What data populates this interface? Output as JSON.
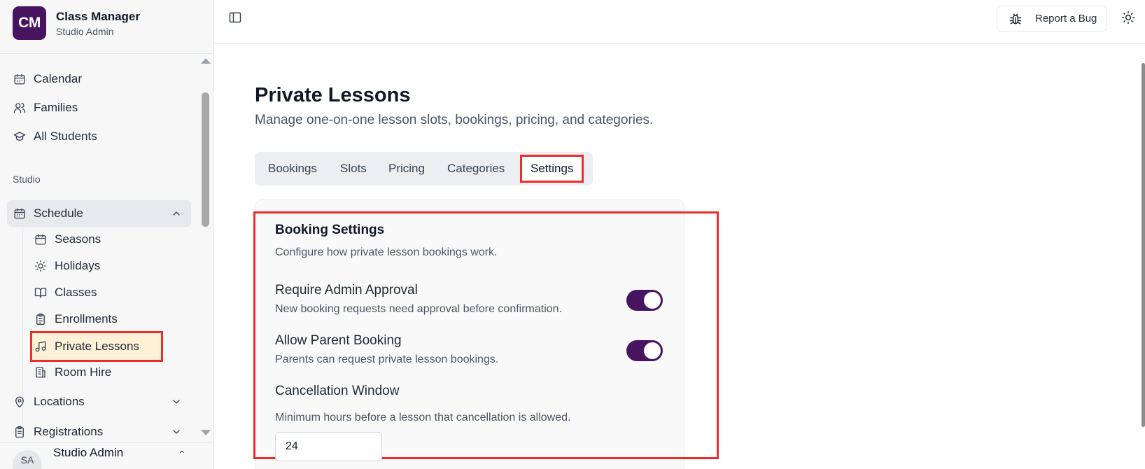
{
  "brand": {
    "logo_text": "CM",
    "name": "Class Manager",
    "subtitle": "Studio Admin",
    "logo_color": "#47155f"
  },
  "sidebar": {
    "top_items": [
      {
        "label": "Calendar",
        "icon": "calendar-icon"
      },
      {
        "label": "Families",
        "icon": "users-icon"
      },
      {
        "label": "All Students",
        "icon": "graduation-cap-icon"
      }
    ],
    "section_label": "Studio",
    "schedule": {
      "label": "Schedule",
      "icon": "calendar-icon",
      "expanded": true,
      "children": [
        {
          "label": "Seasons",
          "icon": "calendar-icon"
        },
        {
          "label": "Holidays",
          "icon": "sun-icon"
        },
        {
          "label": "Classes",
          "icon": "book-open-icon"
        },
        {
          "label": "Enrollments",
          "icon": "clipboard-icon"
        },
        {
          "label": "Private Lessons",
          "icon": "music-icon",
          "active": true
        },
        {
          "label": "Room Hire",
          "icon": "building-icon"
        }
      ]
    },
    "bottom_items": [
      {
        "label": "Locations",
        "icon": "map-pin-icon"
      },
      {
        "label": "Registrations",
        "icon": "clipboard-icon"
      }
    ],
    "user": {
      "avatar": "SA",
      "name": "Studio Admin"
    }
  },
  "topbar": {
    "report_bug_label": "Report a Bug"
  },
  "page": {
    "title": "Private Lessons",
    "subtitle": "Manage one-on-one lesson slots, bookings, pricing, and categories."
  },
  "tabs": [
    "Bookings",
    "Slots",
    "Pricing",
    "Categories",
    "Settings"
  ],
  "active_tab": "Settings",
  "settings": {
    "title": "Booking Settings",
    "description": "Configure how private lesson bookings work.",
    "require_approval": {
      "label": "Require Admin Approval",
      "description": "New booking requests need approval before confirmation.",
      "enabled": true
    },
    "allow_parent": {
      "label": "Allow Parent Booking",
      "description": "Parents can request private lesson bookings.",
      "enabled": true
    },
    "cancellation": {
      "label": "Cancellation Window",
      "description": "Minimum hours before a lesson that cancellation is allowed.",
      "value": "24"
    }
  },
  "colors": {
    "accent": "#47155f",
    "highlight": "#ef2b2b",
    "active_item_bg": "#fdf2d8"
  }
}
